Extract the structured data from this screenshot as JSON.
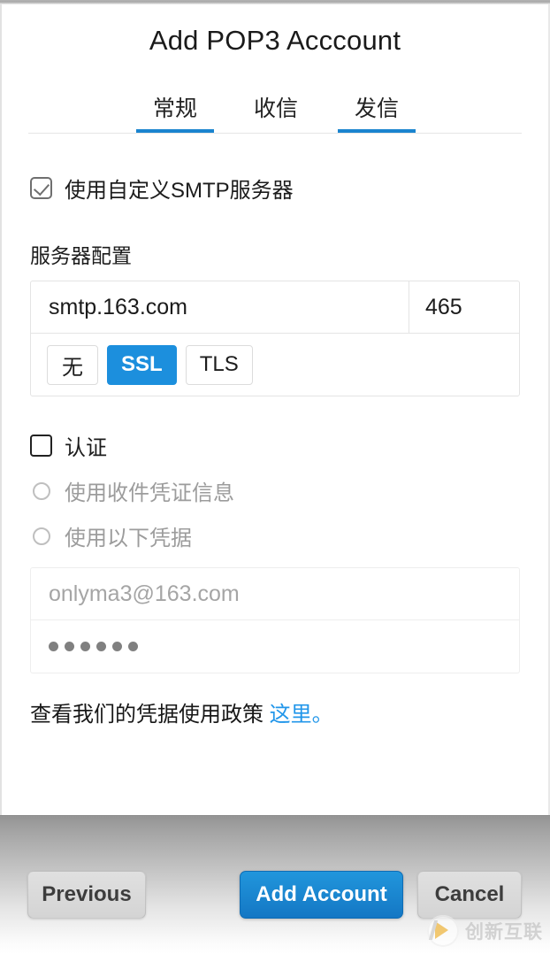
{
  "window": {
    "dialog_title": "Add POP3 Acccount"
  },
  "tabs": [
    {
      "label": "常规",
      "active": true
    },
    {
      "label": "收信",
      "active": false
    },
    {
      "label": "发信",
      "active": true
    }
  ],
  "custom_smtp": {
    "label": "使用自定义SMTP服务器",
    "checked": true
  },
  "server_config": {
    "section_label": "服务器配置",
    "host": "smtp.163.com",
    "port": "465",
    "security_options": [
      {
        "label": "无",
        "selected": false
      },
      {
        "label": "SSL",
        "selected": true
      },
      {
        "label": "TLS",
        "selected": false
      }
    ]
  },
  "auth": {
    "label": "认证",
    "checked": false,
    "options": [
      {
        "label": "使用收件凭证信息",
        "selected": false,
        "disabled": true
      },
      {
        "label": "使用以下凭据",
        "selected": false,
        "disabled": true
      }
    ],
    "email_value": "onlyma3@163.com",
    "password_mask": "••••••",
    "password_dots": 6
  },
  "policy": {
    "text": "查看我们的凭据使用政策 ",
    "link_text": "这里",
    "suffix": "。"
  },
  "footer": {
    "previous_label": "Previous",
    "primary_label": "Add Account",
    "cancel_label": "Cancel"
  },
  "watermark": {
    "text": "创新互联"
  },
  "colors": {
    "accent_blue": "#1c8fdd",
    "tab_underline": "#1a84cf",
    "link_blue": "#2196ea",
    "primary_button": "#1477c4",
    "muted_text": "#9c9c9c"
  }
}
